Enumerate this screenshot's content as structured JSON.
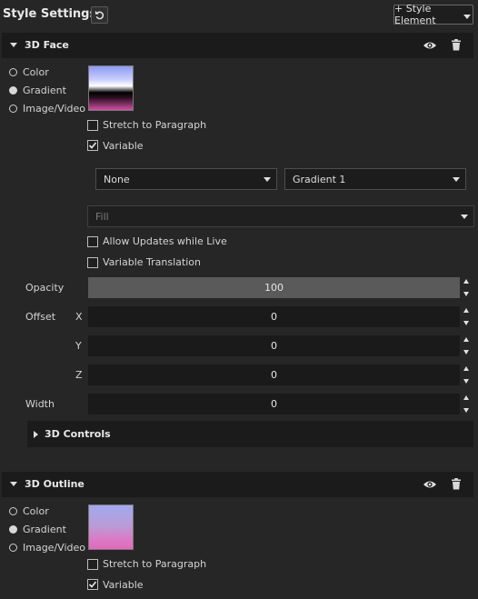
{
  "header": {
    "title": "Style Settings",
    "add_button_label": "+ Style Element"
  },
  "face": {
    "title": "3D Face",
    "fill_types": [
      "Color",
      "Gradient",
      "Image/Video"
    ],
    "selected_fill_type": "Gradient",
    "stretch_label": "Stretch to Paragraph",
    "stretch_checked": false,
    "variable_label": "Variable",
    "variable_checked": true,
    "variable_source": "None",
    "gradient_select": "Gradient 1",
    "fill_select_placeholder": "Fill",
    "allow_updates_label": "Allow Updates while Live",
    "allow_updates_checked": false,
    "variable_translation_label": "Variable Translation",
    "variable_translation_checked": false,
    "opacity_label": "Opacity",
    "opacity_value": "100",
    "offset_label": "Offset",
    "offset_x_label": "X",
    "offset_x": "0",
    "offset_y_label": "Y",
    "offset_y": "0",
    "offset_z_label": "Z",
    "offset_z": "0",
    "width_label": "Width",
    "width_value": "0",
    "controls_title": "3D Controls"
  },
  "outline": {
    "title": "3D Outline",
    "fill_types": [
      "Color",
      "Gradient",
      "Image/Video"
    ],
    "selected_fill_type": "Gradient",
    "stretch_label": "Stretch to Paragraph",
    "stretch_checked": false,
    "variable_label": "Variable",
    "variable_checked": true
  },
  "icons": {
    "reset": "undo-icon",
    "visibility": "eye-icon",
    "delete": "trash-icon"
  },
  "colors": {
    "background": "#262626",
    "header_bg": "#1b1b1b",
    "field_bg": "#1a1a1a",
    "slider_fill": "#5a5a5a"
  }
}
